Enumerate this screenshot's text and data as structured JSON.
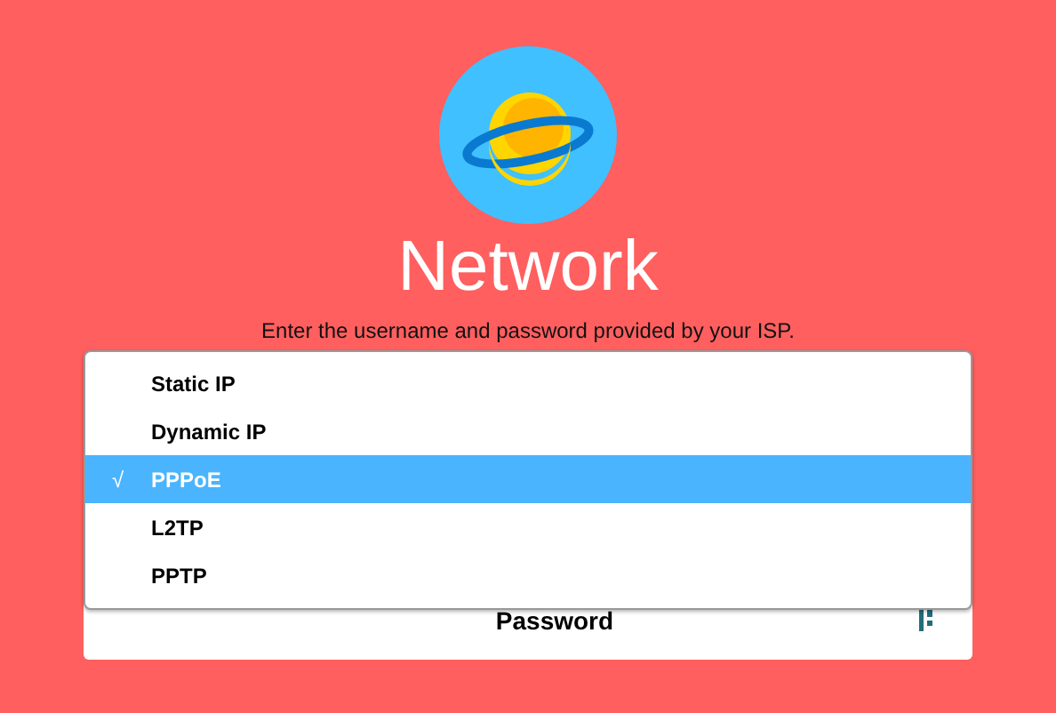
{
  "header": {
    "title": "Network",
    "subtitle": "Enter the username and password provided by your ISP."
  },
  "menu": {
    "check": "√",
    "items": [
      {
        "label": "Static IP",
        "selected": false
      },
      {
        "label": "Dynamic IP",
        "selected": false
      },
      {
        "label": "PPPoE",
        "selected": true
      },
      {
        "label": "L2TP",
        "selected": false
      },
      {
        "label": "PPTP",
        "selected": false
      }
    ]
  },
  "password": {
    "placeholder": "Password"
  }
}
